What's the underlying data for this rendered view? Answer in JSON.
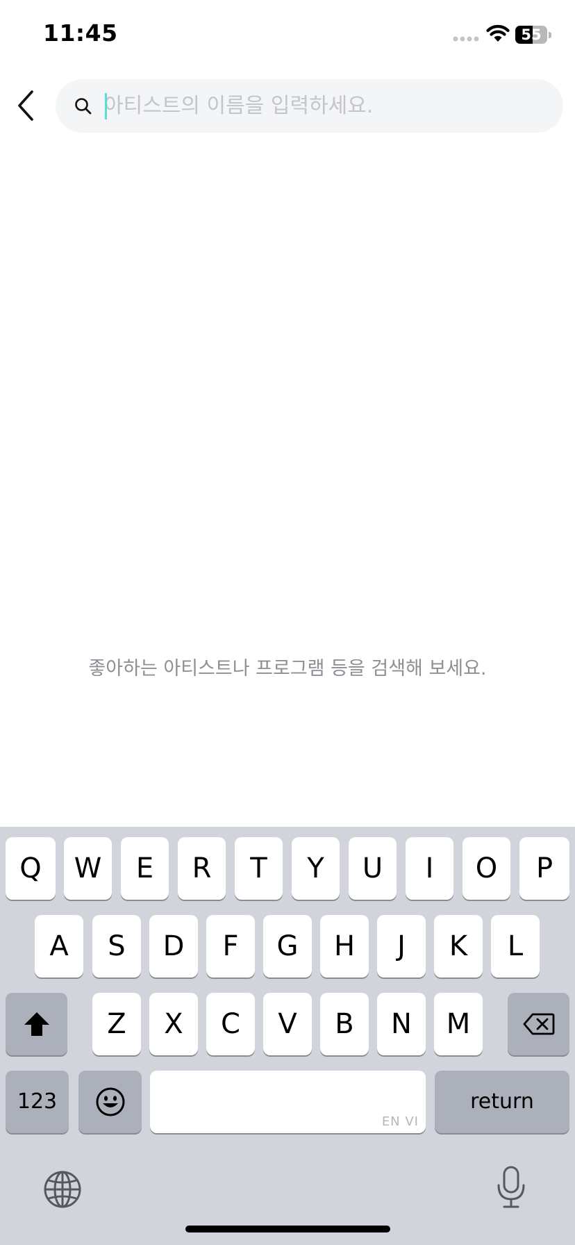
{
  "status_bar": {
    "time": "11:45",
    "battery_level": "55",
    "icons": [
      "signal-icon",
      "wifi-icon",
      "battery-icon"
    ]
  },
  "search": {
    "placeholder": "아티스트의 이름을 입력하세요.",
    "value": "",
    "icons": [
      "back-arrow-icon",
      "search-icon"
    ]
  },
  "empty_state": {
    "message": "좋아하는 아티스트나 프로그램 등을 검색해 보세요."
  },
  "keyboard": {
    "rows": [
      [
        "Q",
        "W",
        "E",
        "R",
        "T",
        "Y",
        "U",
        "I",
        "O",
        "P"
      ],
      [
        "A",
        "S",
        "D",
        "F",
        "G",
        "H",
        "J",
        "K",
        "L"
      ],
      [
        "Z",
        "X",
        "C",
        "V",
        "B",
        "N",
        "M"
      ]
    ],
    "numbers_label": "123",
    "return_label": "return",
    "space_hint": "EN VI",
    "icons": [
      "shift-icon",
      "backspace-icon",
      "emoji-icon",
      "globe-icon",
      "microphone-icon"
    ]
  },
  "colors": {
    "accent_caret": "#57e0d3",
    "search_background": "#f4f5f7",
    "keyboard_background": "#d1d4da"
  }
}
